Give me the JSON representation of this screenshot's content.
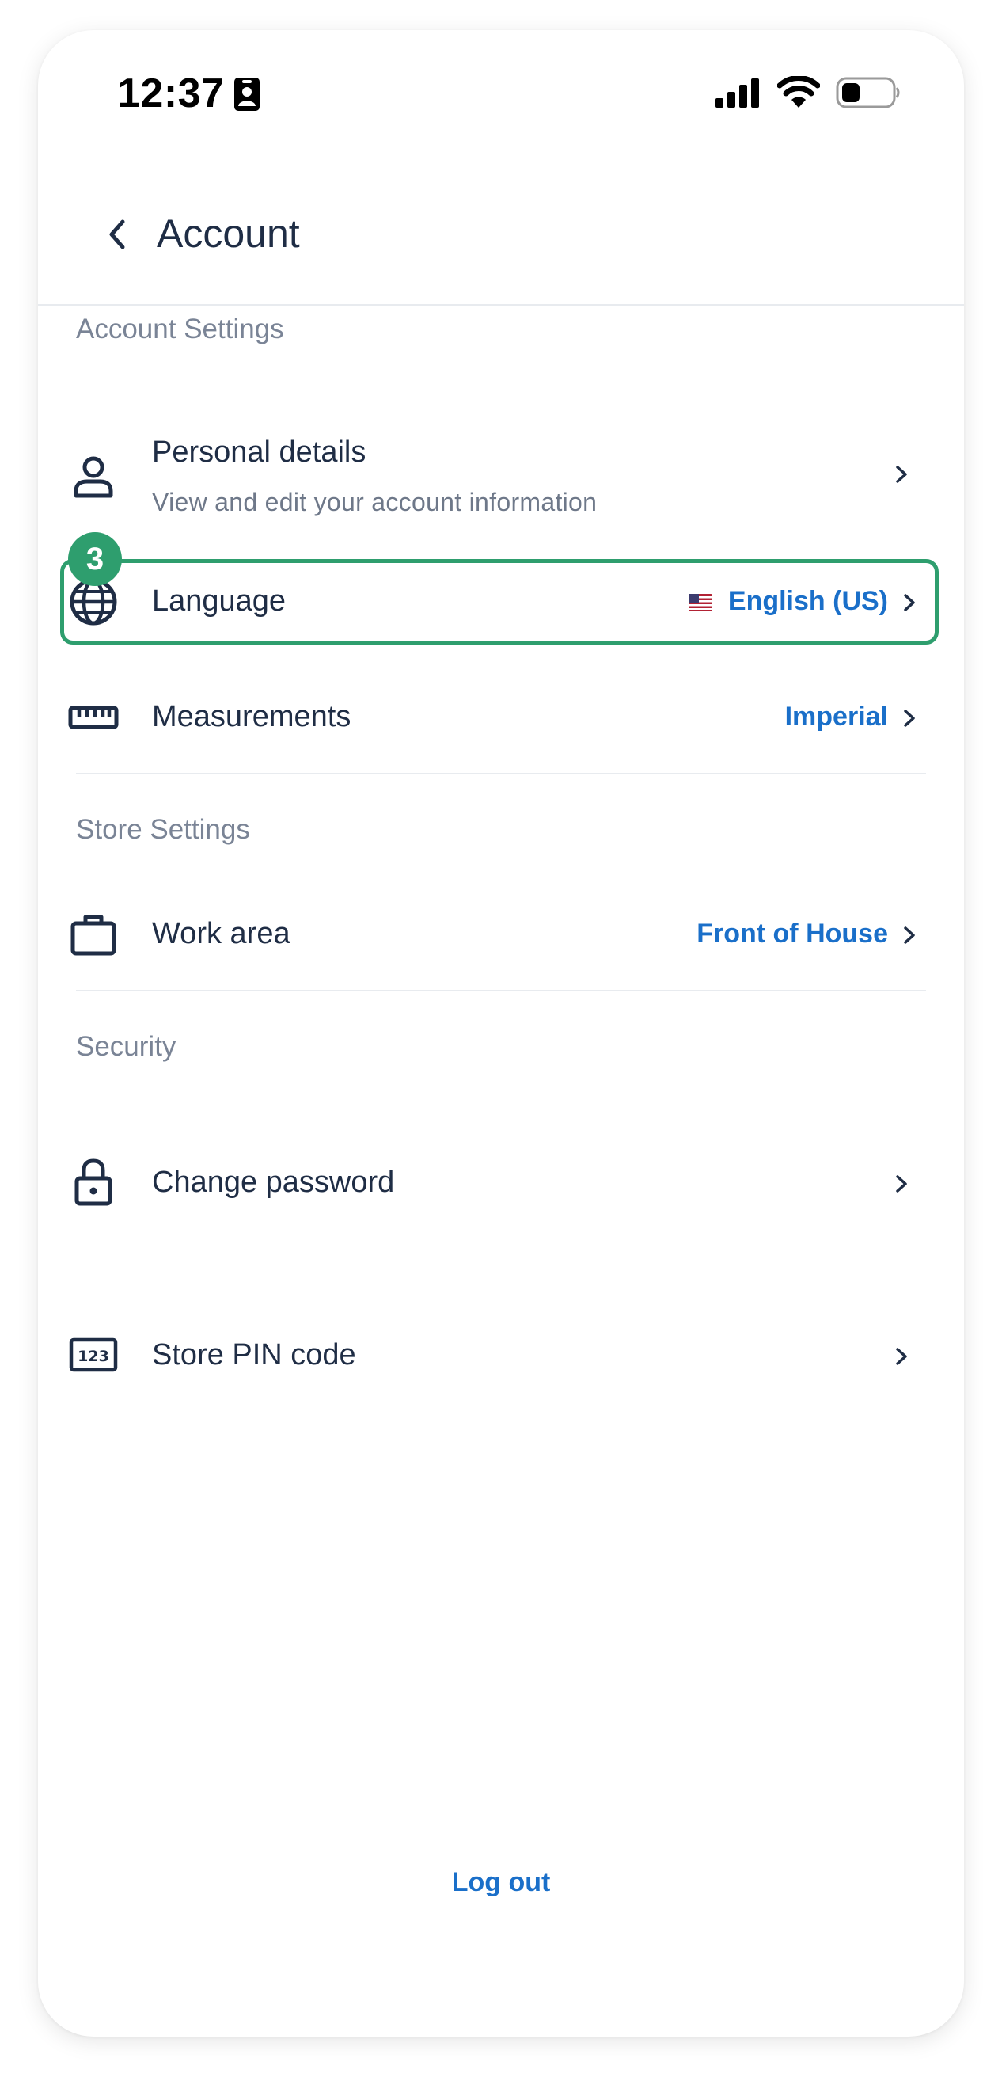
{
  "status_bar": {
    "time": "12:37"
  },
  "header": {
    "title": "Account"
  },
  "sections": {
    "account_settings": "Account Settings",
    "store_settings": "Store Settings",
    "security": "Security"
  },
  "rows": {
    "personal_details": {
      "label": "Personal details",
      "subtitle": "View and edit your account information",
      "icon": "person-icon"
    },
    "language": {
      "label": "Language",
      "value": "English (US)",
      "icon": "globe-icon",
      "flag": "us-flag-icon"
    },
    "measurements": {
      "label": "Measurements",
      "value": "Imperial",
      "icon": "ruler-icon"
    },
    "work_area": {
      "label": "Work area",
      "value": "Front of House",
      "icon": "briefcase-icon"
    },
    "change_password": {
      "label": "Change password",
      "icon": "lock-icon"
    },
    "store_pin": {
      "label": "Store PIN code",
      "icon": "pin-123-icon"
    }
  },
  "annotation": {
    "step_number": "3",
    "highlight_color": "#2e9e6e"
  },
  "footer": {
    "logout_label": "Log out"
  },
  "colors": {
    "text_primary": "#1f2d45",
    "text_secondary": "#7a8496",
    "accent": "#1a6fc9",
    "divider": "#e8ebef"
  }
}
